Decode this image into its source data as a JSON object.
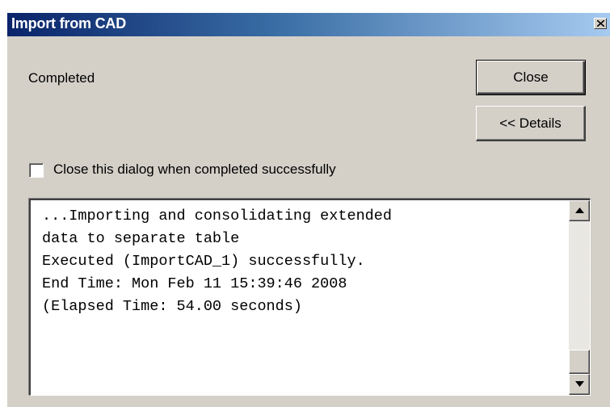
{
  "window": {
    "title": "Import from CAD",
    "close_glyph": "×"
  },
  "status": {
    "text": "Completed"
  },
  "buttons": {
    "close_label": "Close",
    "details_label": "<< Details"
  },
  "options": {
    "close_on_success_label": "Close this dialog when completed successfully",
    "close_on_success_checked": false
  },
  "log": {
    "lines": [
      "...Importing and consolidating extended",
      "data to separate table",
      "Executed (ImportCAD_1) successfully.",
      "End Time: Mon Feb 11 15:39:46 2008",
      "(Elapsed Time: 54.00 seconds)"
    ],
    "scroll_position": 0.95
  },
  "icons": {
    "title_close": "close-icon",
    "scroll_up": "arrow-up-icon",
    "scroll_down": "arrow-down-icon"
  },
  "colors": {
    "titlebar_start": "#0a246a",
    "titlebar_end": "#a6caf0",
    "dialog_face": "#d4d0c8"
  }
}
